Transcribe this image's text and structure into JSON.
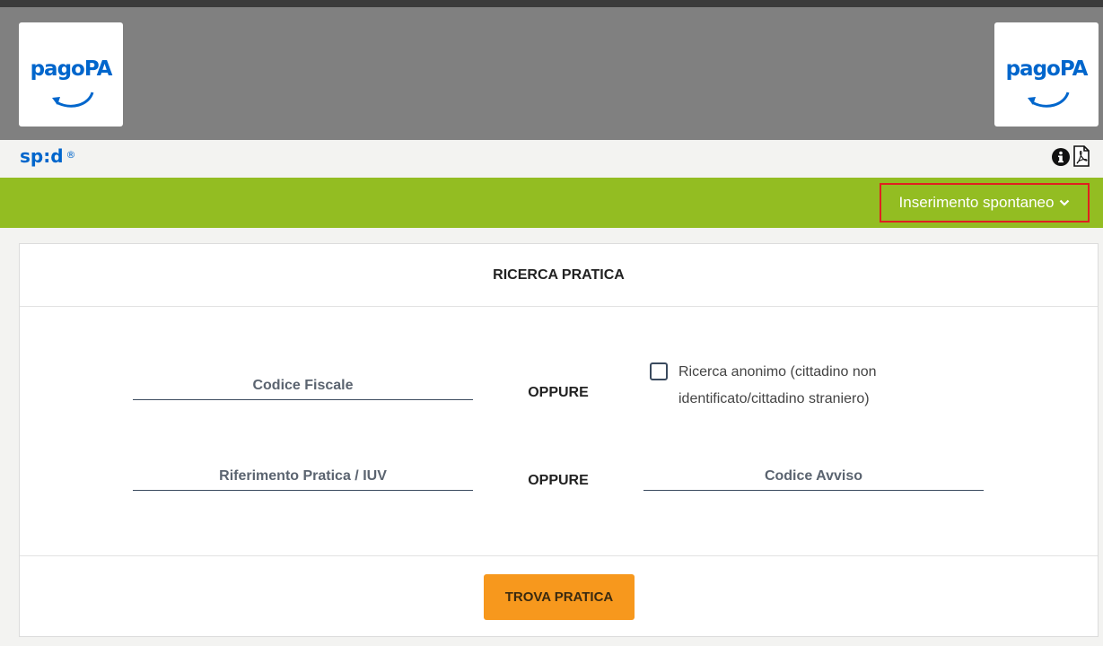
{
  "header": {
    "logo_left_text": "pagoPA",
    "logo_right_text": "pagoPA",
    "logo_color": "#0066cc",
    "background_color": "#808080"
  },
  "toolbar": {
    "spid_text": "sp:d",
    "spid_reg": "®",
    "info_icon": "info-circle-icon",
    "pdf_icon": "file-pdf-icon"
  },
  "nav": {
    "menu_label": "Inserimento spontaneo",
    "menu_icon": "chevron-down-icon",
    "bar_color": "#93bd22",
    "highlight_color": "#e02020"
  },
  "search": {
    "title": "RICERCA PRATICA",
    "codice_fiscale_placeholder": "Codice Fiscale",
    "or_label_1": "OPPURE",
    "anonymous_checkbox_label": "Ricerca anonimo (cittadino non identificato/cittadino straniero)",
    "anonymous_checked": false,
    "riferimento_placeholder": "Riferimento Pratica / IUV",
    "or_label_2": "OPPURE",
    "codice_avviso_placeholder": "Codice Avviso",
    "submit_label": "TROVA PRATICA",
    "submit_color": "#f7981d"
  }
}
